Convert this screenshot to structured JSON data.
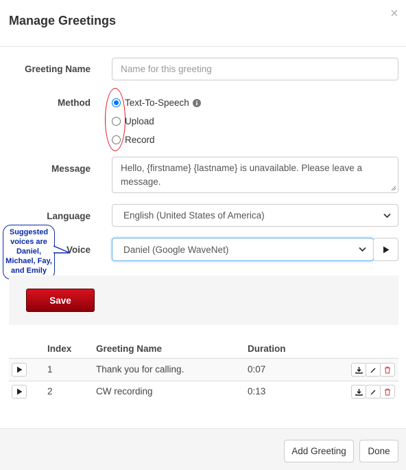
{
  "modal": {
    "title": "Manage Greetings",
    "close_icon": "close-icon"
  },
  "form": {
    "greeting_name": {
      "label": "Greeting Name",
      "value": "",
      "placeholder": "Name for this greeting"
    },
    "method": {
      "label": "Method",
      "options": [
        "Text-To-Speech",
        "Upload",
        "Record"
      ],
      "selected": "Text-To-Speech",
      "info_icon": "info-circle-icon"
    },
    "message": {
      "label": "Message",
      "value": "Hello, {firstname} {lastname} is unavailable. Please leave a message."
    },
    "language": {
      "label": "Language",
      "selected": "English (United States of America)"
    },
    "voice": {
      "label": "Voice",
      "selected": "Daniel (Google WaveNet)",
      "play_icon": "play-icon"
    },
    "save_label": "Save"
  },
  "annotation": {
    "callout_lines": [
      "Suggested",
      "voices are",
      "Daniel,",
      "Michael, Fay,",
      "and Emily"
    ],
    "callout_color": "#0a2aa6",
    "oval_color": "#e0141e"
  },
  "table": {
    "headers": {
      "index": "Index",
      "name": "Greeting Name",
      "duration": "Duration"
    },
    "rows": [
      {
        "index": "1",
        "name": "Thank you for calling.",
        "duration": "0:07"
      },
      {
        "index": "2",
        "name": "CW recording",
        "duration": "0:13"
      }
    ],
    "row_icons": [
      "play-icon",
      "download-icon",
      "edit-icon",
      "trash-icon"
    ]
  },
  "footer": {
    "add_label": "Add Greeting",
    "done_label": "Done"
  },
  "colors": {
    "save_button": "#c0101a",
    "radio_accent": "#0075ff",
    "trash": "#d9534f"
  }
}
